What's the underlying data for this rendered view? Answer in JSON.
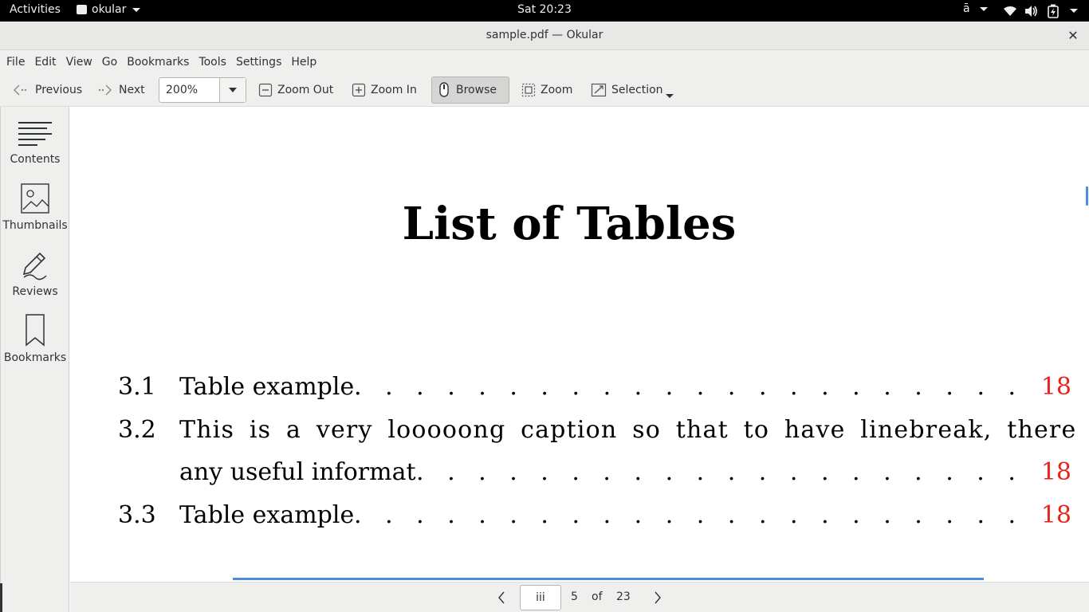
{
  "topbar": {
    "activities": "Activities",
    "app_name": "okular",
    "clock": "Sat 20:23",
    "ime": "ā"
  },
  "window": {
    "title": "sample.pdf — Okular",
    "close": "✕"
  },
  "menu": [
    "File",
    "Edit",
    "View",
    "Go",
    "Bookmarks",
    "Tools",
    "Settings",
    "Help"
  ],
  "toolbar": {
    "previous": "Previous",
    "next": "Next",
    "zoom_value": "200%",
    "zoom_out": "Zoom Out",
    "zoom_in": "Zoom In",
    "browse": "Browse",
    "zoom": "Zoom",
    "selection": "Selection"
  },
  "sidebar": {
    "items": [
      {
        "label": "Contents",
        "icon": "contents-icon"
      },
      {
        "label": "Thumbnails",
        "icon": "thumbnails-icon"
      },
      {
        "label": "Reviews",
        "icon": "reviews-icon"
      },
      {
        "label": "Bookmarks",
        "icon": "bookmarks-icon"
      }
    ]
  },
  "document": {
    "title": "List of Tables",
    "entries": [
      {
        "number": "3.1",
        "text": "Table example",
        "page": "18"
      },
      {
        "number": "3.2",
        "text": "This is a very looooong caption so that to have linebreak, there isn’t",
        "text2": "any useful informat",
        "page": "18"
      },
      {
        "number": "3.3",
        "text": "Table example",
        "page": "18"
      }
    ],
    "dots": ". . . . . . . . . . . . . . . . . . . . . . . . . . . . . . . . . . . . . . . . . . . . ."
  },
  "pagenav": {
    "page_label": "iii",
    "current": "5",
    "of": "of",
    "total": "23"
  },
  "colors": {
    "link": "#e8231c",
    "accent": "#4a90d9"
  }
}
